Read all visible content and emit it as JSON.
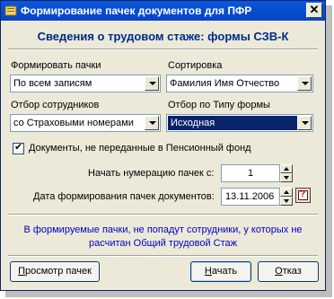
{
  "window": {
    "title": "Формирование пачек документов для ПФР",
    "close": "✕"
  },
  "heading": "Сведения о трудовом стаже: формы СЗВ-К",
  "form_packs": {
    "label": "Формировать пачки",
    "value": "По всем записям"
  },
  "sort": {
    "label": "Сортировка",
    "value": "Фамилия Имя Отчество"
  },
  "employee_filter": {
    "label": "Отбор сотрудников",
    "value": "со Страховыми номерами"
  },
  "form_type_filter": {
    "label": "Отбор по Типу формы",
    "value": "Исходная"
  },
  "checkbox": {
    "label": "Документы, не переданные в Пенсионный фонд",
    "checked": true
  },
  "numbering": {
    "label": "Начать нумерацию пачек с:",
    "value": "1"
  },
  "date": {
    "label": "Дата формирования пачек документов:",
    "value": "13.11.2006"
  },
  "note": {
    "line1": "В формируемые пачки, не попадут сотрудники, у которых не",
    "line2": "расчитан Общий трудовой Стаж"
  },
  "buttons": {
    "preview_u": "П",
    "preview_rest": "росмотр пачек",
    "start_u": "Н",
    "start_rest": "ачать",
    "cancel_u": "О",
    "cancel_rest": "тказ"
  }
}
